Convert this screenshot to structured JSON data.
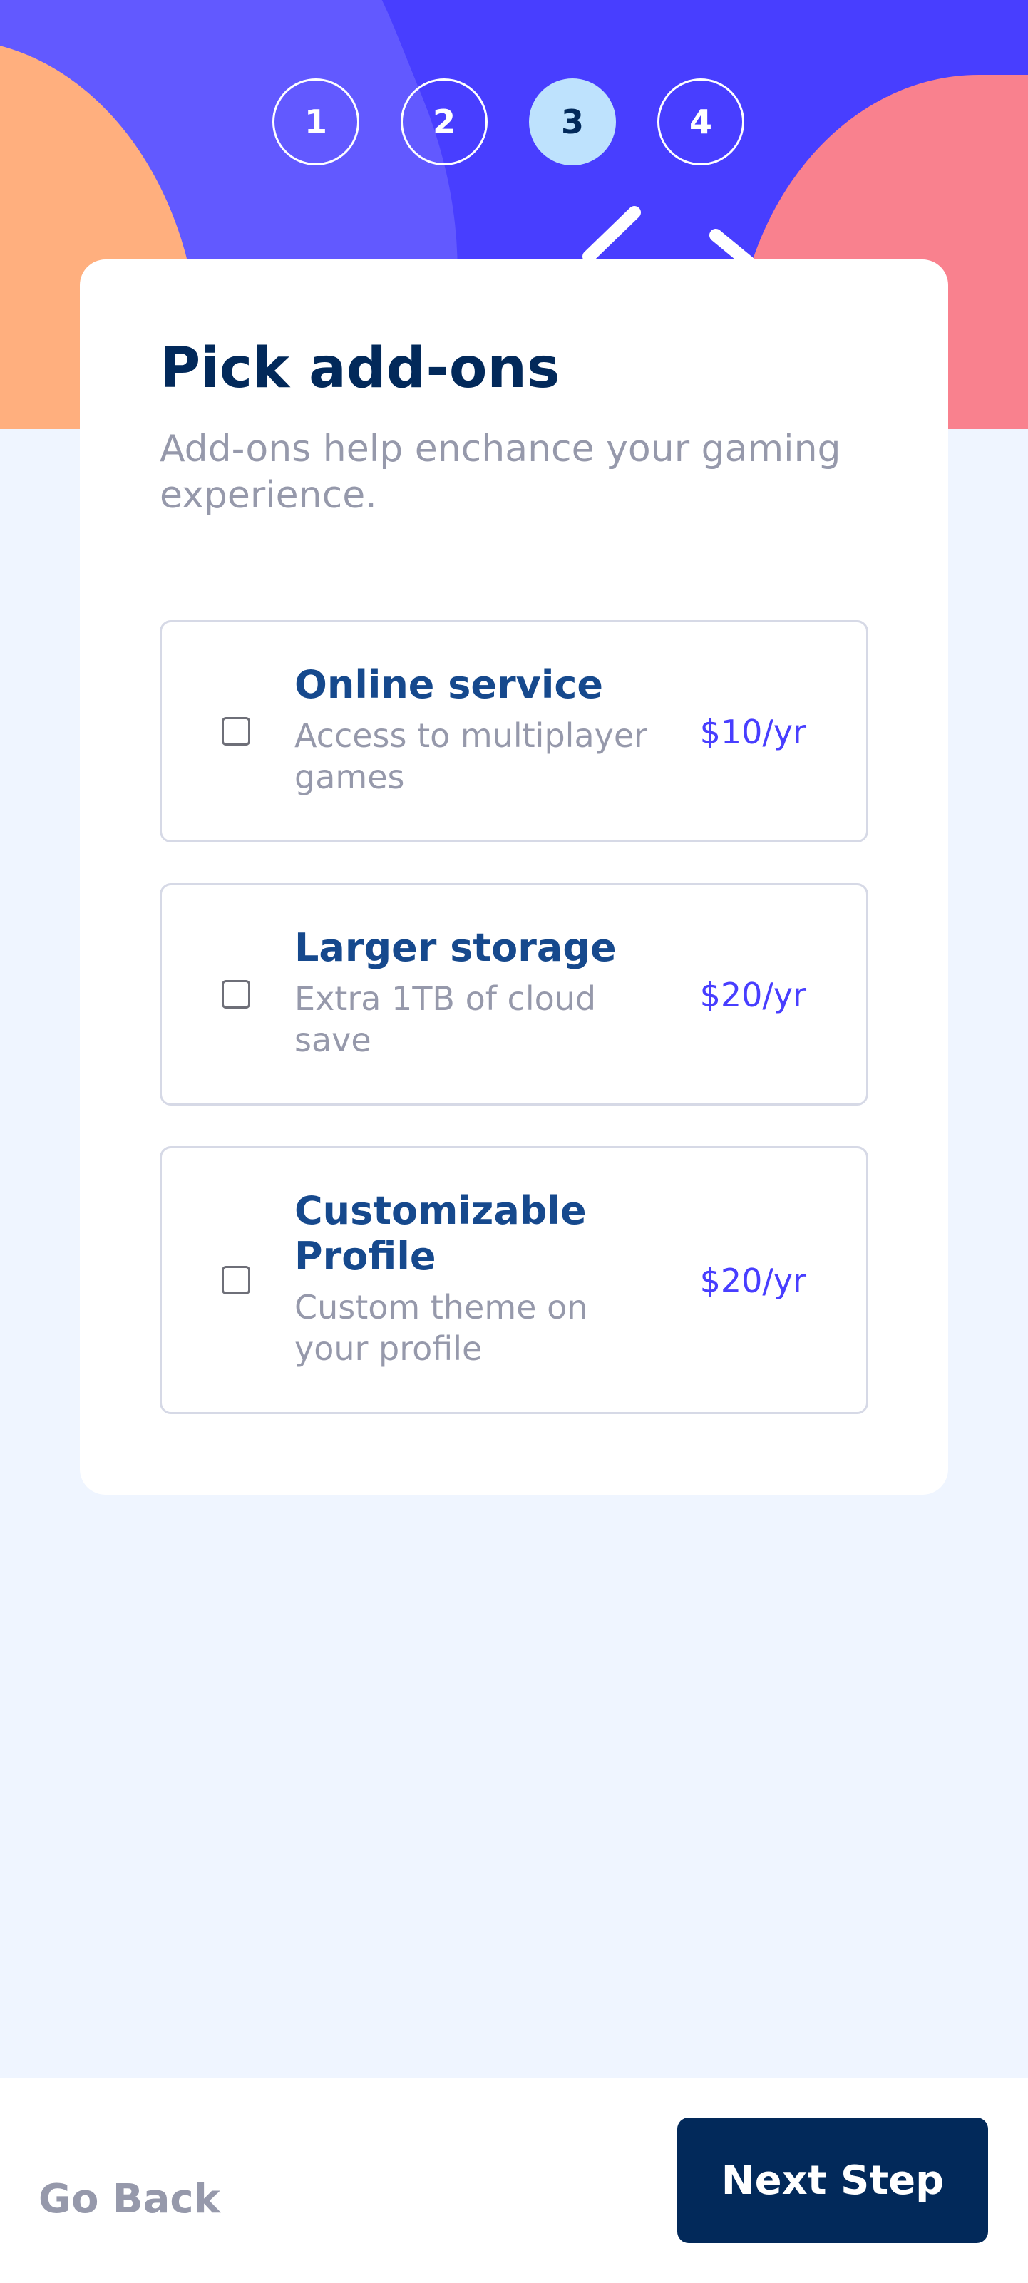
{
  "steps": [
    {
      "number": "1",
      "active": false
    },
    {
      "number": "2",
      "active": false
    },
    {
      "number": "3",
      "active": true
    },
    {
      "number": "4",
      "active": false
    }
  ],
  "header": {
    "title": "Pick add-ons",
    "subtitle": "Add-ons help enchance your gaming experience."
  },
  "addons": [
    {
      "name": "Online service",
      "description": "Access to multiplayer games",
      "price": "$10/yr",
      "checked": false
    },
    {
      "name": "Larger storage",
      "description": "Extra 1TB of cloud save",
      "price": "$20/yr",
      "checked": false
    },
    {
      "name": "Customizable Profile",
      "description": "Custom theme on your profile",
      "price": "$20/yr",
      "checked": false
    }
  ],
  "footer": {
    "back_label": "Go Back",
    "next_label": "Next Step"
  },
  "colors": {
    "accent": "#483eff",
    "navy": "#02295a",
    "background": "#eff5ff",
    "muted": "#9699ab"
  }
}
